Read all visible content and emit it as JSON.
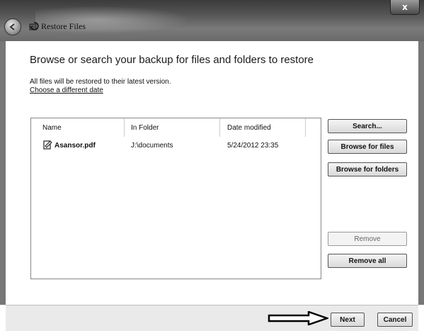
{
  "window": {
    "title": "Restore Files",
    "close_glyph": "x"
  },
  "header": {
    "heading": "Browse or search your backup for files and folders to restore",
    "note": "All files will be restored to their latest version.",
    "link": "Choose a different date"
  },
  "table": {
    "columns": [
      "Name",
      "In Folder",
      "Date modified"
    ],
    "rows": [
      {
        "name": "Asansor.pdf",
        "folder": "J:\\documents",
        "date": "5/24/2012 23:35",
        "icon": "pdf-file-icon"
      }
    ]
  },
  "side_buttons": {
    "search": "Search...",
    "browse_files": "Browse for files",
    "browse_folders": "Browse for folders",
    "remove": "Remove",
    "remove_all": "Remove all"
  },
  "footer": {
    "next": "Next",
    "cancel": "Cancel"
  }
}
